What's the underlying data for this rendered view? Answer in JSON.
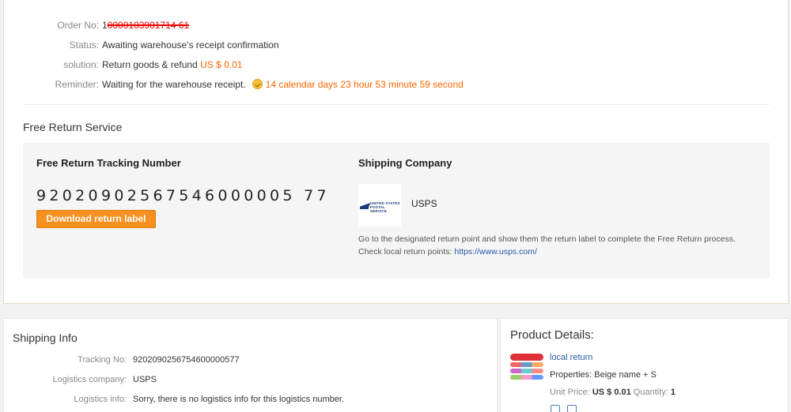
{
  "order": {
    "order_no_label": "Order No:",
    "order_no_value": "1",
    "order_no_redacted": "0000103901714 61",
    "status_label": "Status:",
    "status_value": "Awaiting warehouse's receipt confirmation",
    "solution_label": "solution:",
    "solution_value": "Return goods & refund",
    "solution_amount": "US $ 0.01",
    "reminder_label": "Reminder:",
    "reminder_value": "Waiting for the warehouse receipt.",
    "reminder_countdown": "14 calendar days 23 hour 53 minute 59 second"
  },
  "free_return": {
    "title": "Free Return Service",
    "tracking_title": "Free Return Tracking Number",
    "tracking_number": "92020902567546000005 77",
    "download_label": "Download return label",
    "shipping_title": "Shipping Company",
    "logo_text": "UNITED STATES POSTAL SERVICE",
    "company": "USPS",
    "desc": "Go to the designated return point and show them the return label to complete the Free Return process.",
    "check_text": "Check local return points:",
    "check_link": "https://www.usps.com/"
  },
  "shipping_info": {
    "title": "Shipping Info",
    "tracking_label": "Tracking No:",
    "tracking_value": "9202090256754600000577",
    "company_label": "Logistics company:",
    "company_value": "USPS",
    "info_label": "Logistics info:",
    "info_value": "Sorry, there is no logistics info for this logistics number."
  },
  "product": {
    "title": "Product Details:",
    "name": "local return",
    "properties_label": "Properties:",
    "properties_value": "Beige name + S",
    "unit_price_label": "Unit Price:",
    "unit_price_value": "US $ 0.01",
    "quantity_label": "Quantity:",
    "quantity_value": "1"
  },
  "colors": {
    "accent_orange": "#f6911f",
    "status_green": "#2c9d2c",
    "countdown_orange": "#ff6600",
    "link_blue": "#2a58a8"
  },
  "icons": [
    "clock-check-icon",
    "usps-logo",
    "return-icon",
    "receipt-icon"
  ]
}
